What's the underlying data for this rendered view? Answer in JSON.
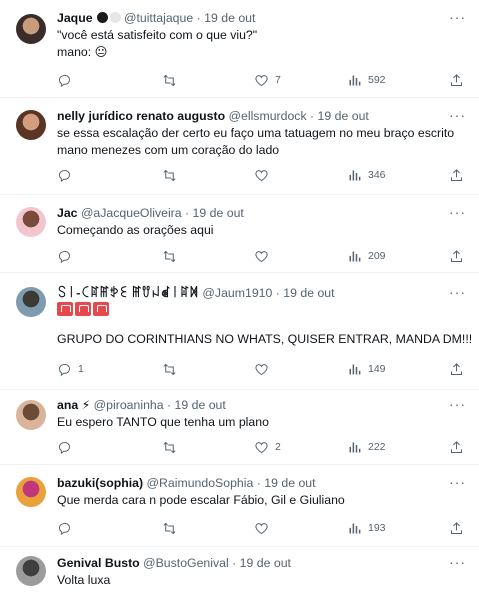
{
  "tweets": [
    {
      "name": "Jaque",
      "badges": "⚫⚪",
      "handle": "@tuittajaque",
      "date": "19 de out",
      "lines": [
        "\"você está satisfeito com o que viu?\"",
        "mano: 😐"
      ],
      "replies": "",
      "retweets": "",
      "likes": "7",
      "views": "592",
      "avatar_colors": [
        "#3a2c2a",
        "#c89b7b"
      ]
    },
    {
      "name": "nelly jurídico renato augusto",
      "handle": "@ellsmurdock",
      "date": "19 de out",
      "lines": [
        "se essa escalação der certo eu faço uma tatuagem no meu braço escrito",
        "mano menezes com um coração do lado"
      ],
      "replies": "",
      "retweets": "",
      "likes": "",
      "views": "346",
      "avatar_colors": [
        "#5a3524",
        "#d59d80"
      ]
    },
    {
      "name": "Jac",
      "handle": "@aJacqueOliveira",
      "date": "19 de out",
      "lines": [
        "Começando as orações aqui"
      ],
      "replies": "",
      "retweets": "",
      "likes": "",
      "views": "209",
      "avatar_colors": [
        "#f3c6cf",
        "#7a4a3a"
      ]
    },
    {
      "name": "ꇙ꒐-ꉔꍏꂵꉣꏂ ꂵꀎꈤꀷ꒐ꍏꁒ",
      "handle": "@Jaum1910",
      "date": "19 de out",
      "lines": [
        "🚨🚨🚨",
        "",
        "GRUPO DO CORINTHIANS NO WHATS, QUISER ENTRAR, MANDA DM!!!"
      ],
      "replies": "1",
      "retweets": "",
      "likes": "",
      "views": "149",
      "avatar_colors": [
        "#7e9bb0",
        "#3d3a36"
      ]
    },
    {
      "name": "ana ⚡",
      "handle": "@piroaninha",
      "date": "19 de out",
      "lines": [
        "Eu espero TANTO que tenha um plano"
      ],
      "replies": "",
      "retweets": "",
      "likes": "2",
      "views": "222",
      "avatar_colors": [
        "#d9b49a",
        "#6b4a36"
      ]
    },
    {
      "name": "bazuki(sophia)",
      "handle": "@RaimundoSophia",
      "date": "19 de out",
      "lines": [
        "Que merda cara n pode escalar Fábio, Gil e Giuliano"
      ],
      "replies": "",
      "retweets": "",
      "likes": "",
      "views": "193",
      "avatar_colors": [
        "#e9a23b",
        "#c2377a"
      ]
    },
    {
      "name": "Genival Busto",
      "handle": "@BustoGenival",
      "date": "19 de out",
      "lines": [
        "Volta luxa"
      ],
      "replies": "",
      "retweets": "",
      "likes": "",
      "views": "",
      "avatar_colors": [
        "#9c9c9c",
        "#3f3f3f"
      ]
    }
  ]
}
